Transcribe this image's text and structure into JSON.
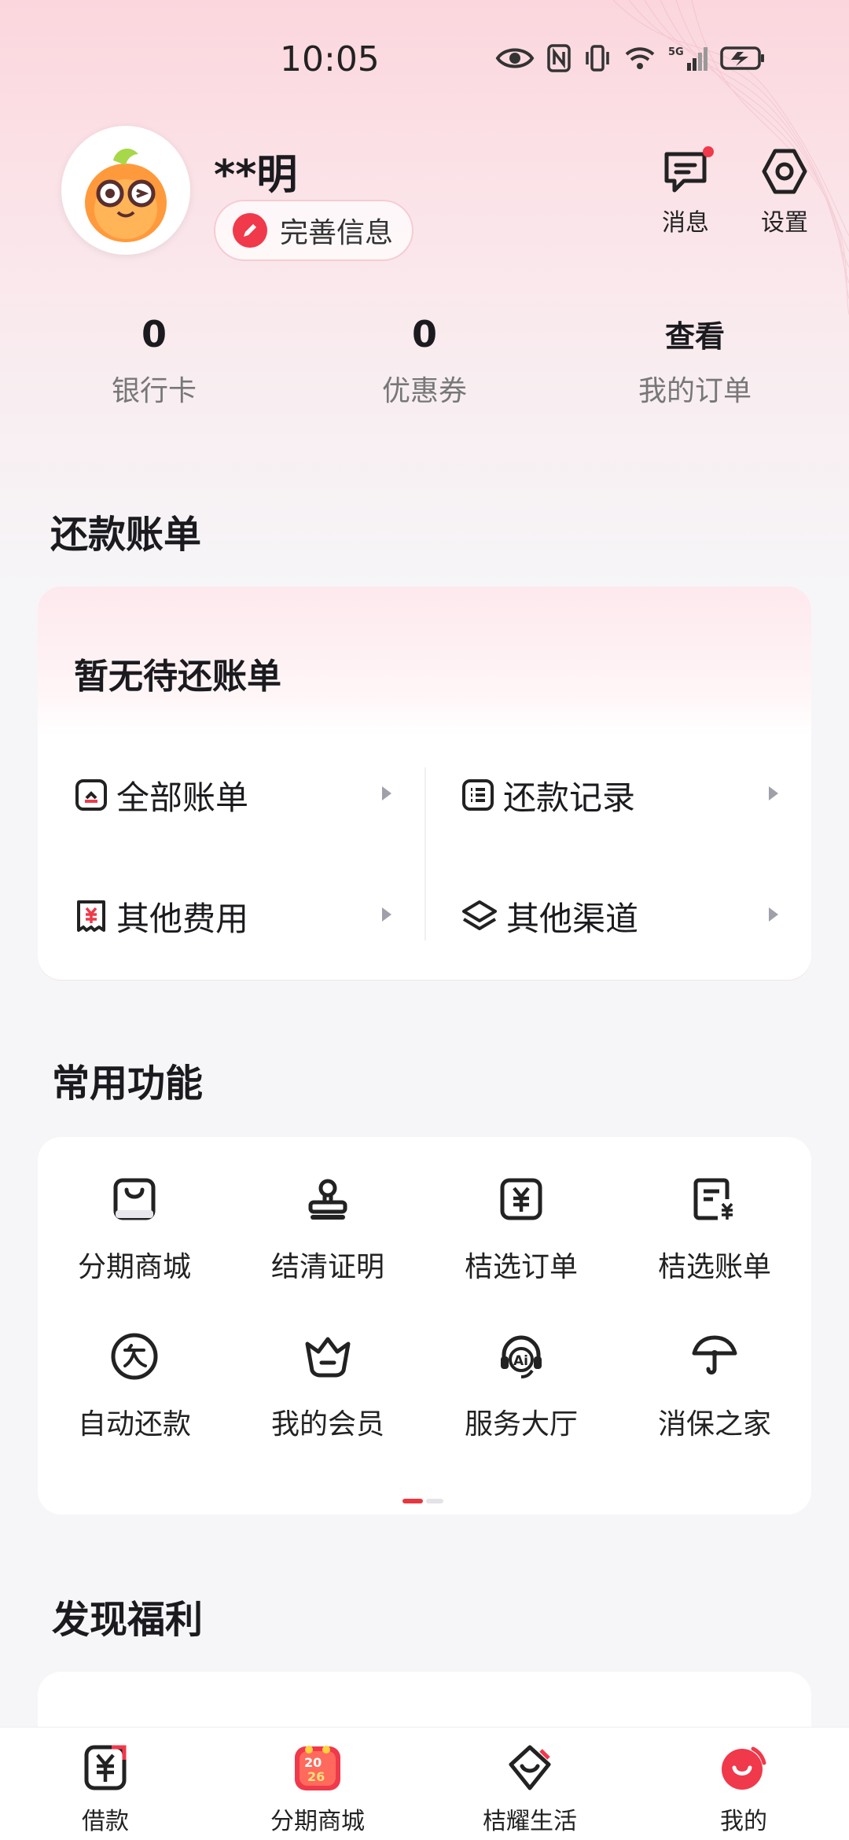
{
  "status_bar": {
    "time": "10:05"
  },
  "profile": {
    "username": "**明",
    "complete_info_label": "完善信息"
  },
  "top_actions": {
    "messages_label": "消息",
    "settings_label": "设置"
  },
  "stats": [
    {
      "value": "0",
      "caption": "银行卡"
    },
    {
      "value": "0",
      "caption": "优惠券"
    },
    {
      "value": "查看",
      "caption": "我的订单"
    }
  ],
  "repay_section": {
    "title": "还款账单",
    "empty_text": "暂无待还账单",
    "items": [
      {
        "label": "全部账单",
        "icon": "bill-icon"
      },
      {
        "label": "还款记录",
        "icon": "list-icon"
      },
      {
        "label": "其他费用",
        "icon": "receipt-icon"
      },
      {
        "label": "其他渠道",
        "icon": "layers-icon"
      }
    ]
  },
  "functions_section": {
    "title": "常用功能",
    "items": [
      {
        "label": "分期商城",
        "icon": "bag-icon"
      },
      {
        "label": "结清证明",
        "icon": "stamp-icon"
      },
      {
        "label": "桔选订单",
        "icon": "yuan-order-icon"
      },
      {
        "label": "桔选账单",
        "icon": "yuan-bill-icon"
      },
      {
        "label": "自动还款",
        "icon": "auto-repay-icon"
      },
      {
        "label": "我的会员",
        "icon": "crown-icon"
      },
      {
        "label": "服务大厅",
        "icon": "ai-headset-icon"
      },
      {
        "label": "消保之家",
        "icon": "umbrella-icon"
      }
    ],
    "page_indicator": {
      "current": 1,
      "total": 2
    }
  },
  "welfare_section": {
    "title": "发现福利"
  },
  "tab_bar": [
    {
      "label": "借款",
      "icon": "loan-icon"
    },
    {
      "label": "分期商城",
      "icon": "mall-2026-icon"
    },
    {
      "label": "桔耀生活",
      "icon": "life-icon"
    },
    {
      "label": "我的",
      "icon": "me-icon",
      "active": true
    }
  ],
  "colors": {
    "accent": "#f0394b",
    "text": "#1b1b1f",
    "muted": "#777777"
  }
}
